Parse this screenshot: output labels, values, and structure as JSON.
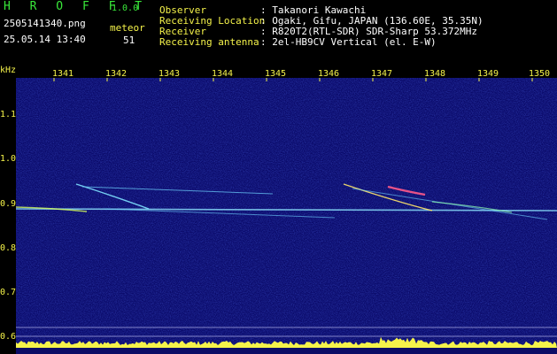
{
  "app": {
    "title": "H R O F F T",
    "version": "1.0.0",
    "filename": "2505141340.png",
    "datetime": "25.05.14 13:40",
    "meteor_label": "meteor",
    "meteor_count": "51"
  },
  "info": {
    "rows": [
      {
        "key": "Observer",
        "value": ": Takanori Kawachi"
      },
      {
        "key": "Receiving Location",
        "value": ": Ogaki, Gifu, JAPAN (136.60E, 35.35N)"
      },
      {
        "key": "Receiver",
        "value": ": R820T2(RTL-SDR) SDR-Sharp 53.372MHz"
      },
      {
        "key": "Receiving antenna",
        "value": ": 2el-HB9CV Vertical (el. E-W)"
      }
    ]
  },
  "axis": {
    "unit": "kHz",
    "y_ticks": [
      "1.1",
      "1.0",
      "0.9",
      "0.8",
      "0.7",
      "0.6"
    ],
    "x_ticks": [
      "1341",
      "1342",
      "1343",
      "1344",
      "1345",
      "1346",
      "1347",
      "1348",
      "1349",
      "1350"
    ]
  },
  "colors": {
    "background": "#0a0a6a",
    "text_green": "#39e83a",
    "text_yellow": "#f5f34a",
    "text_white": "#ffffff"
  }
}
